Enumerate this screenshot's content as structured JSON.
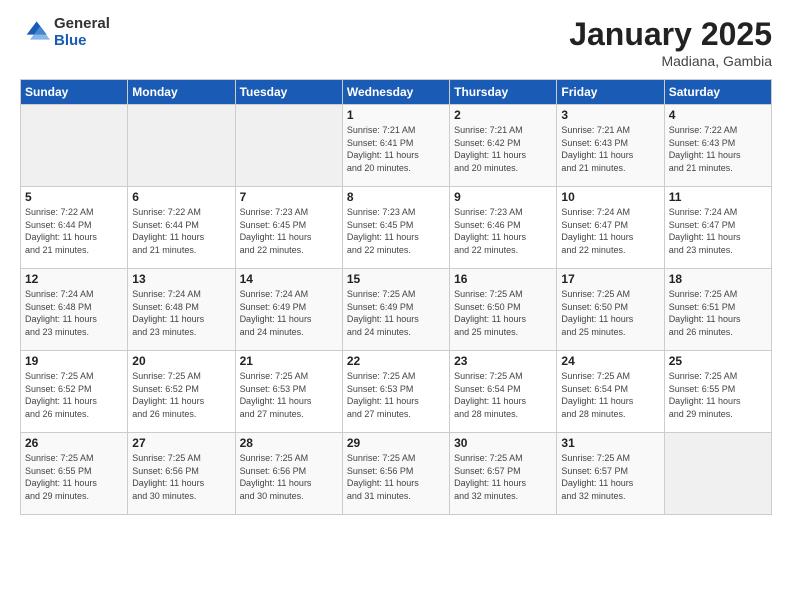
{
  "header": {
    "logo_general": "General",
    "logo_blue": "Blue",
    "title": "January 2025",
    "location": "Madiana, Gambia"
  },
  "days_of_week": [
    "Sunday",
    "Monday",
    "Tuesday",
    "Wednesday",
    "Thursday",
    "Friday",
    "Saturday"
  ],
  "weeks": [
    [
      {
        "day": "",
        "info": ""
      },
      {
        "day": "",
        "info": ""
      },
      {
        "day": "",
        "info": ""
      },
      {
        "day": "1",
        "info": "Sunrise: 7:21 AM\nSunset: 6:41 PM\nDaylight: 11 hours\nand 20 minutes."
      },
      {
        "day": "2",
        "info": "Sunrise: 7:21 AM\nSunset: 6:42 PM\nDaylight: 11 hours\nand 20 minutes."
      },
      {
        "day": "3",
        "info": "Sunrise: 7:21 AM\nSunset: 6:43 PM\nDaylight: 11 hours\nand 21 minutes."
      },
      {
        "day": "4",
        "info": "Sunrise: 7:22 AM\nSunset: 6:43 PM\nDaylight: 11 hours\nand 21 minutes."
      }
    ],
    [
      {
        "day": "5",
        "info": "Sunrise: 7:22 AM\nSunset: 6:44 PM\nDaylight: 11 hours\nand 21 minutes."
      },
      {
        "day": "6",
        "info": "Sunrise: 7:22 AM\nSunset: 6:44 PM\nDaylight: 11 hours\nand 21 minutes."
      },
      {
        "day": "7",
        "info": "Sunrise: 7:23 AM\nSunset: 6:45 PM\nDaylight: 11 hours\nand 22 minutes."
      },
      {
        "day": "8",
        "info": "Sunrise: 7:23 AM\nSunset: 6:45 PM\nDaylight: 11 hours\nand 22 minutes."
      },
      {
        "day": "9",
        "info": "Sunrise: 7:23 AM\nSunset: 6:46 PM\nDaylight: 11 hours\nand 22 minutes."
      },
      {
        "day": "10",
        "info": "Sunrise: 7:24 AM\nSunset: 6:47 PM\nDaylight: 11 hours\nand 22 minutes."
      },
      {
        "day": "11",
        "info": "Sunrise: 7:24 AM\nSunset: 6:47 PM\nDaylight: 11 hours\nand 23 minutes."
      }
    ],
    [
      {
        "day": "12",
        "info": "Sunrise: 7:24 AM\nSunset: 6:48 PM\nDaylight: 11 hours\nand 23 minutes."
      },
      {
        "day": "13",
        "info": "Sunrise: 7:24 AM\nSunset: 6:48 PM\nDaylight: 11 hours\nand 23 minutes."
      },
      {
        "day": "14",
        "info": "Sunrise: 7:24 AM\nSunset: 6:49 PM\nDaylight: 11 hours\nand 24 minutes."
      },
      {
        "day": "15",
        "info": "Sunrise: 7:25 AM\nSunset: 6:49 PM\nDaylight: 11 hours\nand 24 minutes."
      },
      {
        "day": "16",
        "info": "Sunrise: 7:25 AM\nSunset: 6:50 PM\nDaylight: 11 hours\nand 25 minutes."
      },
      {
        "day": "17",
        "info": "Sunrise: 7:25 AM\nSunset: 6:50 PM\nDaylight: 11 hours\nand 25 minutes."
      },
      {
        "day": "18",
        "info": "Sunrise: 7:25 AM\nSunset: 6:51 PM\nDaylight: 11 hours\nand 26 minutes."
      }
    ],
    [
      {
        "day": "19",
        "info": "Sunrise: 7:25 AM\nSunset: 6:52 PM\nDaylight: 11 hours\nand 26 minutes."
      },
      {
        "day": "20",
        "info": "Sunrise: 7:25 AM\nSunset: 6:52 PM\nDaylight: 11 hours\nand 26 minutes."
      },
      {
        "day": "21",
        "info": "Sunrise: 7:25 AM\nSunset: 6:53 PM\nDaylight: 11 hours\nand 27 minutes."
      },
      {
        "day": "22",
        "info": "Sunrise: 7:25 AM\nSunset: 6:53 PM\nDaylight: 11 hours\nand 27 minutes."
      },
      {
        "day": "23",
        "info": "Sunrise: 7:25 AM\nSunset: 6:54 PM\nDaylight: 11 hours\nand 28 minutes."
      },
      {
        "day": "24",
        "info": "Sunrise: 7:25 AM\nSunset: 6:54 PM\nDaylight: 11 hours\nand 28 minutes."
      },
      {
        "day": "25",
        "info": "Sunrise: 7:25 AM\nSunset: 6:55 PM\nDaylight: 11 hours\nand 29 minutes."
      }
    ],
    [
      {
        "day": "26",
        "info": "Sunrise: 7:25 AM\nSunset: 6:55 PM\nDaylight: 11 hours\nand 29 minutes."
      },
      {
        "day": "27",
        "info": "Sunrise: 7:25 AM\nSunset: 6:56 PM\nDaylight: 11 hours\nand 30 minutes."
      },
      {
        "day": "28",
        "info": "Sunrise: 7:25 AM\nSunset: 6:56 PM\nDaylight: 11 hours\nand 30 minutes."
      },
      {
        "day": "29",
        "info": "Sunrise: 7:25 AM\nSunset: 6:56 PM\nDaylight: 11 hours\nand 31 minutes."
      },
      {
        "day": "30",
        "info": "Sunrise: 7:25 AM\nSunset: 6:57 PM\nDaylight: 11 hours\nand 32 minutes."
      },
      {
        "day": "31",
        "info": "Sunrise: 7:25 AM\nSunset: 6:57 PM\nDaylight: 11 hours\nand 32 minutes."
      },
      {
        "day": "",
        "info": ""
      }
    ]
  ]
}
